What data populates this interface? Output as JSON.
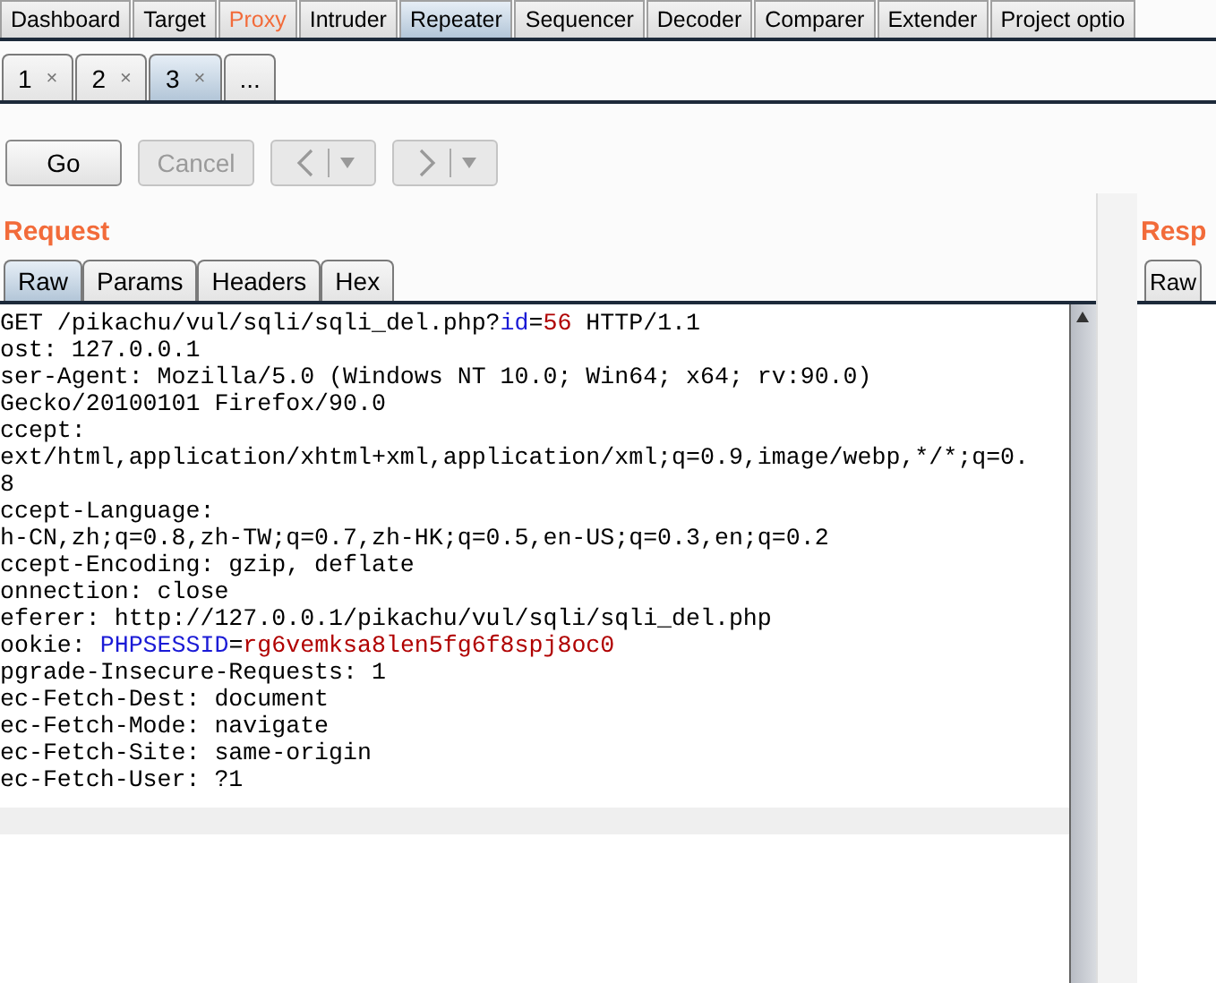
{
  "main_tabs": [
    {
      "label": "Dashboard",
      "selected": false,
      "highlighted": false
    },
    {
      "label": "Target",
      "selected": false,
      "highlighted": false
    },
    {
      "label": "Proxy",
      "selected": false,
      "highlighted": true
    },
    {
      "label": "Intruder",
      "selected": false,
      "highlighted": false
    },
    {
      "label": "Repeater",
      "selected": true,
      "highlighted": false
    },
    {
      "label": "Sequencer",
      "selected": false,
      "highlighted": false
    },
    {
      "label": "Decoder",
      "selected": false,
      "highlighted": false
    },
    {
      "label": "Comparer",
      "selected": false,
      "highlighted": false
    },
    {
      "label": "Extender",
      "selected": false,
      "highlighted": false
    },
    {
      "label": "Project optio",
      "selected": false,
      "highlighted": false
    }
  ],
  "repeater_tabs": [
    {
      "label": "1",
      "close": "×",
      "selected": false
    },
    {
      "label": "2",
      "close": "×",
      "selected": false
    },
    {
      "label": "3",
      "close": "×",
      "selected": true
    },
    {
      "label": "...",
      "selected": false
    }
  ],
  "toolbar": [
    {
      "kind": "text",
      "label": "Go",
      "disabled": false
    },
    {
      "kind": "text",
      "label": "Cancel",
      "disabled": true
    },
    {
      "kind": "back",
      "disabled": true
    },
    {
      "kind": "forward",
      "disabled": true
    }
  ],
  "request": {
    "title": "Request",
    "tabs": [
      {
        "label": "Raw",
        "selected": true
      },
      {
        "label": "Params",
        "selected": false
      },
      {
        "label": "Headers",
        "selected": false
      },
      {
        "label": "Hex",
        "selected": false
      }
    ],
    "lines": [
      [
        {
          "kind": "plain",
          "text": "GET /pikachu/vul/sqli/sqli_del.php?"
        },
        {
          "kind": "name",
          "text": "id"
        },
        {
          "kind": "plain",
          "text": "="
        },
        {
          "kind": "value",
          "text": "56"
        },
        {
          "kind": "plain",
          "text": " HTTP/1.1"
        }
      ],
      [
        {
          "kind": "plain",
          "text": "ost: 127.0.0.1"
        }
      ],
      [
        {
          "kind": "plain",
          "text": "ser-Agent: Mozilla/5.0 (Windows NT 10.0; Win64; x64; rv:90.0)"
        }
      ],
      [
        {
          "kind": "plain",
          "text": "Gecko/20100101 Firefox/90.0"
        }
      ],
      [
        {
          "kind": "plain",
          "text": "ccept:"
        }
      ],
      [
        {
          "kind": "plain",
          "text": "ext/html,application/xhtml+xml,application/xml;q=0.9,image/webp,*/*;q=0."
        }
      ],
      [
        {
          "kind": "plain",
          "text": "8"
        }
      ],
      [
        {
          "kind": "plain",
          "text": "ccept-Language:"
        }
      ],
      [
        {
          "kind": "plain",
          "text": "h-CN,zh;q=0.8,zh-TW;q=0.7,zh-HK;q=0.5,en-US;q=0.3,en;q=0.2"
        }
      ],
      [
        {
          "kind": "plain",
          "text": "ccept-Encoding: gzip, deflate"
        }
      ],
      [
        {
          "kind": "plain",
          "text": "onnection: close"
        }
      ],
      [
        {
          "kind": "plain",
          "text": "eferer: http://127.0.0.1/pikachu/vul/sqli/sqli_del.php"
        }
      ],
      [
        {
          "kind": "plain",
          "text": "ookie: "
        },
        {
          "kind": "name",
          "text": "PHPSESSID"
        },
        {
          "kind": "plain",
          "text": "="
        },
        {
          "kind": "value",
          "text": "rg6vemksa8len5fg6f8spj8oc0"
        }
      ],
      [
        {
          "kind": "plain",
          "text": "pgrade-Insecure-Requests: 1"
        }
      ],
      [
        {
          "kind": "plain",
          "text": "ec-Fetch-Dest: document"
        }
      ],
      [
        {
          "kind": "plain",
          "text": "ec-Fetch-Mode: navigate"
        }
      ],
      [
        {
          "kind": "plain",
          "text": "ec-Fetch-Site: same-origin"
        }
      ],
      [
        {
          "kind": "plain",
          "text": "ec-Fetch-User: ?1"
        }
      ]
    ]
  },
  "response": {
    "title": "Resp",
    "tabs": [
      {
        "label": "Raw",
        "selected": false
      }
    ]
  }
}
